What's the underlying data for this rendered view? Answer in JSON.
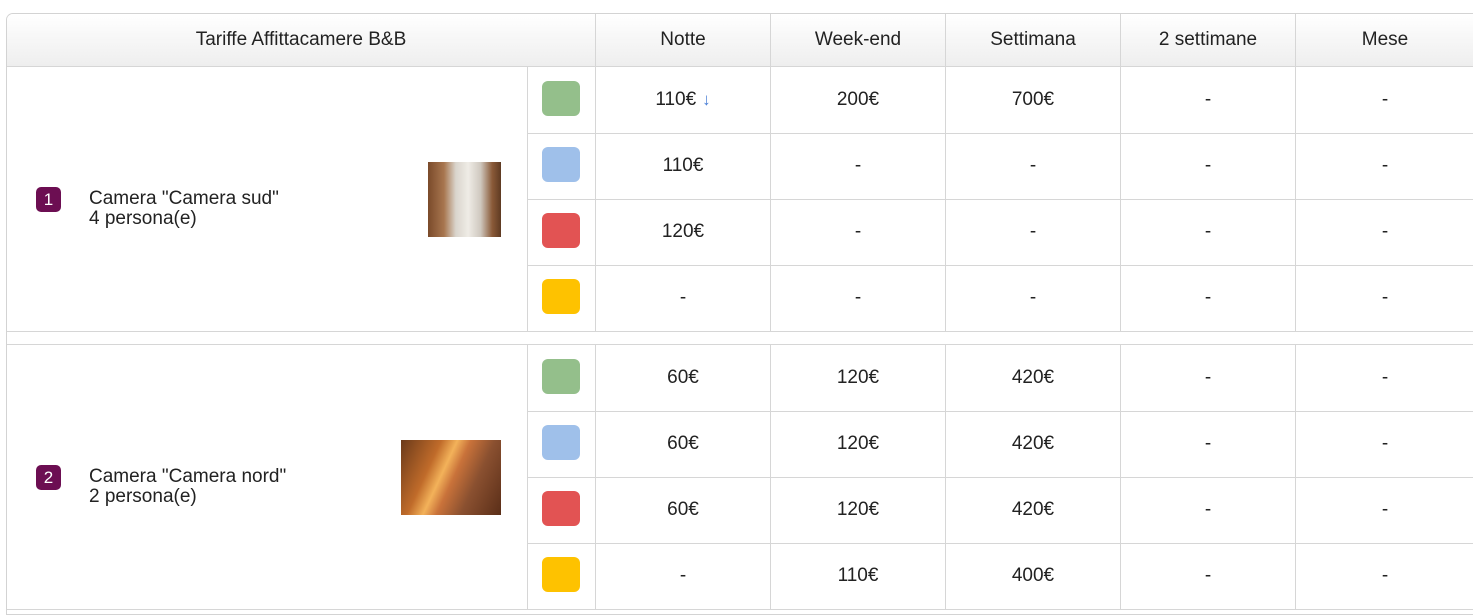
{
  "table": {
    "title": "Tariffe Affittacamere B&B",
    "columns": [
      "Notte",
      "Week-end",
      "Settimana",
      "2 settimane",
      "Mese"
    ],
    "rate_colors": [
      "#94bf8b",
      "#9fc0ea",
      "#e25353",
      "#fec200"
    ],
    "rooms": [
      {
        "number": "1",
        "name": "Camera \"Camera sud\"",
        "capacity": "4 persona(e)",
        "rows": [
          {
            "color": "#94bf8b",
            "values": [
              "110€",
              "200€",
              "700€",
              "-",
              "-"
            ],
            "notte_icon": "↓"
          },
          {
            "color": "#9fc0ea",
            "values": [
              "110€",
              "-",
              "-",
              "-",
              "-"
            ]
          },
          {
            "color": "#e25353",
            "values": [
              "120€",
              "-",
              "-",
              "-",
              "-"
            ]
          },
          {
            "color": "#fec200",
            "values": [
              "-",
              "-",
              "-",
              "-",
              "-"
            ]
          }
        ]
      },
      {
        "number": "2",
        "name": "Camera \"Camera nord\"",
        "capacity": "2 persona(e)",
        "rows": [
          {
            "color": "#94bf8b",
            "values": [
              "60€",
              "120€",
              "420€",
              "-",
              "-"
            ]
          },
          {
            "color": "#9fc0ea",
            "values": [
              "60€",
              "120€",
              "420€",
              "-",
              "-"
            ]
          },
          {
            "color": "#e25353",
            "values": [
              "60€",
              "120€",
              "420€",
              "-",
              "-"
            ]
          },
          {
            "color": "#fec200",
            "values": [
              "-",
              "110€",
              "400€",
              "-",
              "-"
            ]
          }
        ]
      }
    ]
  }
}
